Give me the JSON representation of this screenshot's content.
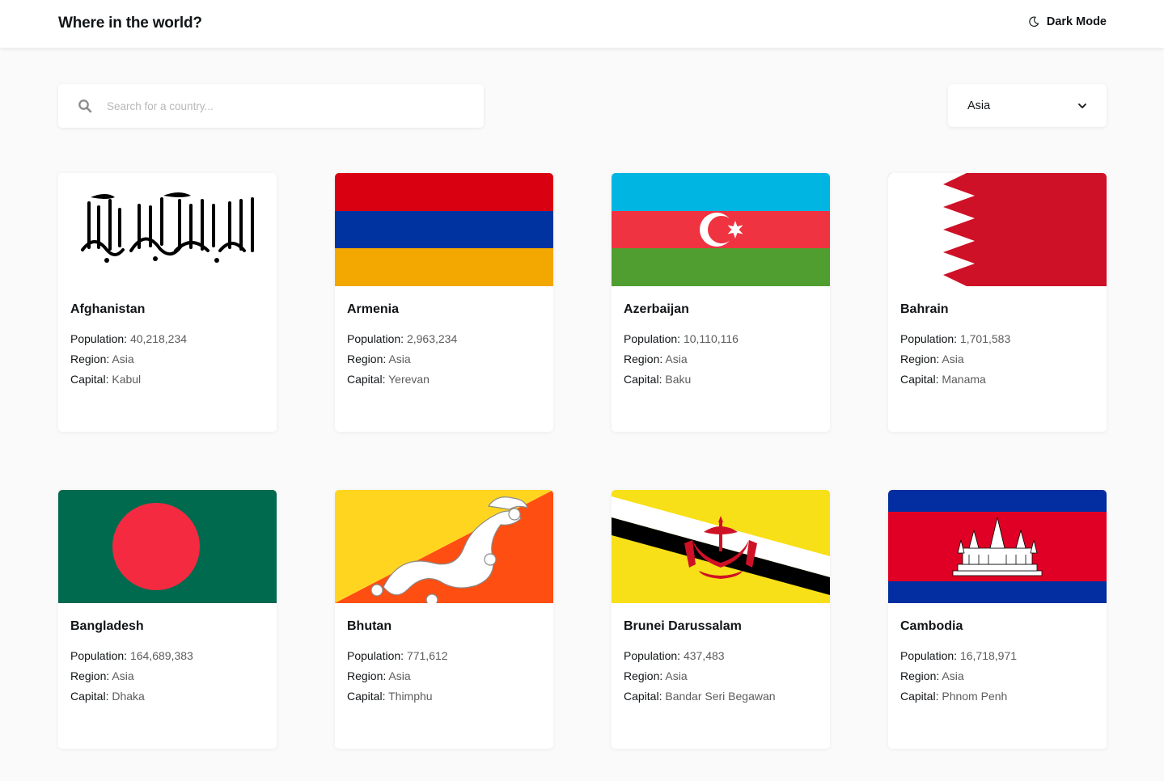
{
  "header": {
    "title": "Where in the world?",
    "theme_toggle_label": "Dark Mode"
  },
  "search": {
    "placeholder": "Search for a country...",
    "value": ""
  },
  "filter": {
    "selected": "Asia"
  },
  "labels": {
    "population": "Population:",
    "region": "Region:",
    "capital": "Capital:"
  },
  "countries": [
    {
      "name": "Afghanistan",
      "population": "40,218,234",
      "region": "Asia",
      "capital": "Kabul",
      "flag": "afghanistan-flag"
    },
    {
      "name": "Armenia",
      "population": "2,963,234",
      "region": "Asia",
      "capital": "Yerevan",
      "flag": "armenia-flag"
    },
    {
      "name": "Azerbaijan",
      "population": "10,110,116",
      "region": "Asia",
      "capital": "Baku",
      "flag": "azerbaijan-flag"
    },
    {
      "name": "Bahrain",
      "population": "1,701,583",
      "region": "Asia",
      "capital": "Manama",
      "flag": "bahrain-flag"
    },
    {
      "name": "Bangladesh",
      "population": "164,689,383",
      "region": "Asia",
      "capital": "Dhaka",
      "flag": "bangladesh-flag"
    },
    {
      "name": "Bhutan",
      "population": "771,612",
      "region": "Asia",
      "capital": "Thimphu",
      "flag": "bhutan-flag"
    },
    {
      "name": "Brunei Darussalam",
      "population": "437,483",
      "region": "Asia",
      "capital": "Bandar Seri Begawan",
      "flag": "brunei-flag"
    },
    {
      "name": "Cambodia",
      "population": "16,718,971",
      "region": "Asia",
      "capital": "Phnom Penh",
      "flag": "cambodia-flag"
    }
  ],
  "colors": {
    "background": "#fafafa",
    "card": "#ffffff",
    "text": "#111517",
    "value_text": "#5c5c5c"
  }
}
